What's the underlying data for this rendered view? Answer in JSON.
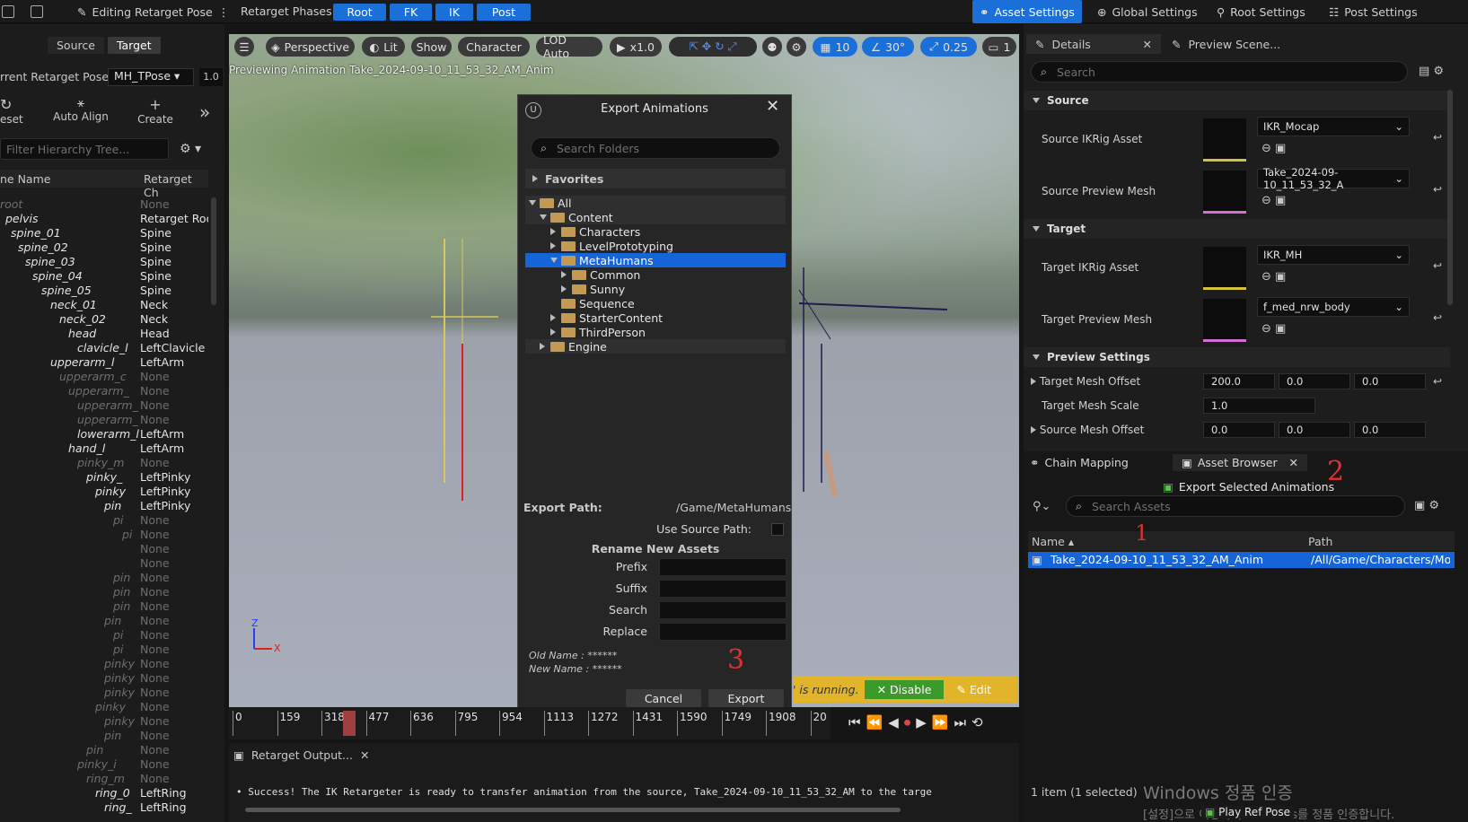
{
  "topbar": {
    "editing_label": "Editing Retarget Pose",
    "phases_label": "Retarget Phases:",
    "phases": [
      "Root",
      "FK",
      "IK",
      "Post"
    ],
    "asset_settings": "Asset Settings",
    "global_settings": "Global Settings",
    "root_settings": "Root Settings",
    "post_settings": "Post Settings"
  },
  "left": {
    "tab_source": "Source",
    "tab_target": "Target",
    "current_pose_label": "rrent Retarget Pose:",
    "current_pose_value": "MH_TPose",
    "pose_blend": "1.0",
    "reset_label": "eset",
    "auto_align_label": "Auto Align",
    "create_label": "Create",
    "filter_placeholder": "Filter Hierarchy Tree...",
    "col_name": "ne Name",
    "col_chain": "Retarget Ch",
    "rows": [
      {
        "name": "root",
        "chain": "None",
        "dim": true
      },
      {
        "name": "pelvis",
        "chain": "Retarget Roo"
      },
      {
        "name": "spine_01",
        "chain": "Spine"
      },
      {
        "name": "spine_02",
        "chain": "Spine"
      },
      {
        "name": "spine_03",
        "chain": "Spine"
      },
      {
        "name": "spine_04",
        "chain": "Spine"
      },
      {
        "name": "spine_05",
        "chain": "Spine"
      },
      {
        "name": "neck_01",
        "chain": "Neck"
      },
      {
        "name": "neck_02",
        "chain": "Neck"
      },
      {
        "name": "head",
        "chain": "Head"
      },
      {
        "name": "clavicle_l",
        "chain": "LeftClavicle"
      },
      {
        "name": "upperarm_l",
        "chain": "LeftArm"
      },
      {
        "name": "upperarm_c",
        "chain": "None",
        "dim": true
      },
      {
        "name": "upperarm_",
        "chain": "None",
        "dim": true
      },
      {
        "name": "upperarm_",
        "chain": "None",
        "dim": true
      },
      {
        "name": "upperarm_",
        "chain": "None",
        "dim": true
      },
      {
        "name": "lowerarm_l",
        "chain": "LeftArm"
      },
      {
        "name": "hand_l",
        "chain": "LeftArm"
      },
      {
        "name": "pinky_m",
        "chain": "None",
        "dim": true
      },
      {
        "name": "pinky_",
        "chain": "LeftPinky"
      },
      {
        "name": "pinky",
        "chain": "LeftPinky"
      },
      {
        "name": "pin",
        "chain": "LeftPinky"
      },
      {
        "name": "pi",
        "chain": "None",
        "dim": true
      },
      {
        "name": "pi",
        "chain": "None",
        "dim": true
      },
      {
        "name": "",
        "chain": "None",
        "dim": true
      },
      {
        "name": "",
        "chain": "None",
        "dim": true
      },
      {
        "name": "pin",
        "chain": "None",
        "dim": true
      },
      {
        "name": "pin",
        "chain": "None",
        "dim": true
      },
      {
        "name": "pin",
        "chain": "None",
        "dim": true
      },
      {
        "name": "pin",
        "chain": "None",
        "dim": true
      },
      {
        "name": "pi",
        "chain": "None",
        "dim": true
      },
      {
        "name": "pi",
        "chain": "None",
        "dim": true
      },
      {
        "name": "pinky",
        "chain": "None",
        "dim": true
      },
      {
        "name": "pinky",
        "chain": "None",
        "dim": true
      },
      {
        "name": "pinky",
        "chain": "None",
        "dim": true
      },
      {
        "name": "pinky",
        "chain": "None",
        "dim": true
      },
      {
        "name": "pinky",
        "chain": "None",
        "dim": true
      },
      {
        "name": "pin",
        "chain": "None",
        "dim": true
      },
      {
        "name": "pin",
        "chain": "None",
        "dim": true
      },
      {
        "name": "pinky_i",
        "chain": "None",
        "dim": true
      },
      {
        "name": "ring_m",
        "chain": "None",
        "dim": true
      },
      {
        "name": "ring_0",
        "chain": "LeftRing"
      },
      {
        "name": "ring_",
        "chain": "LeftRing"
      }
    ]
  },
  "viewport": {
    "view_mode": "Perspective",
    "lit": "Lit",
    "show": "Show",
    "character": "Character",
    "lod": "LOD Auto",
    "speed": "x1.0",
    "grid": "10",
    "angle": "30°",
    "scale": "0.25",
    "cam": "1",
    "preview_text": "Previewing Animation Take_2024-09-10_11_53_32_AM_Anim",
    "running_text": "' is running.",
    "disable_label": "Disable",
    "edit_label": "Edit"
  },
  "dialog": {
    "title": "Export Animations",
    "search_placeholder": "Search Folders",
    "favorites": "Favorites",
    "folders": [
      {
        "name": "All",
        "depth": 0,
        "open": true
      },
      {
        "name": "Content",
        "depth": 1,
        "open": true
      },
      {
        "name": "Characters",
        "depth": 2
      },
      {
        "name": "LevelPrototyping",
        "depth": 2
      },
      {
        "name": "MetaHumans",
        "depth": 2,
        "open": true,
        "selected": true
      },
      {
        "name": "Common",
        "depth": 3
      },
      {
        "name": "Sunny",
        "depth": 3
      },
      {
        "name": "Sequence",
        "depth": 2,
        "leaf": true
      },
      {
        "name": "StarterContent",
        "depth": 2
      },
      {
        "name": "ThirdPerson",
        "depth": 2
      },
      {
        "name": "Engine",
        "depth": 1
      }
    ],
    "export_path_label": "Export Path:",
    "export_path_value": "/Game/MetaHumans",
    "use_source_label": "Use Source Path:",
    "rename_header": "Rename New Assets",
    "prefix": "Prefix",
    "suffix": "Suffix",
    "search": "Search",
    "replace": "Replace",
    "old_name": "Old Name : ******",
    "new_name": "New Name : ******",
    "cancel": "Cancel",
    "export": "Export"
  },
  "details": {
    "tab": "Details",
    "tab2": "Preview Scene...",
    "search_placeholder": "Search",
    "source_header": "Source",
    "source_ikrig_label": "Source IKRig Asset",
    "source_ikrig_value": "IKR_Mocap",
    "source_mesh_label": "Source Preview Mesh",
    "source_mesh_value": "Take_2024-09-10_11_53_32_A",
    "target_header": "Target",
    "target_ikrig_label": "Target IKRig Asset",
    "target_ikrig_value": "IKR_MH",
    "target_mesh_label": "Target Preview Mesh",
    "target_mesh_value": "f_med_nrw_body",
    "preview_header": "Preview Settings",
    "target_offset_label": "Target Mesh Offset",
    "target_offset": [
      "200.0",
      "0.0",
      "0.0"
    ],
    "target_scale_label": "Target Mesh Scale",
    "target_scale": "1.0",
    "source_offset_label": "Source Mesh Offset",
    "source_offset": [
      "0.0",
      "0.0",
      "0.0"
    ]
  },
  "assets": {
    "tab_chain": "Chain Mapping",
    "tab_browser": "Asset Browser",
    "export_selected": "Export Selected Animations",
    "search_placeholder": "Search Assets",
    "col_name": "Name",
    "col_path": "Path",
    "row_name": "Take_2024-09-10_11_53_32_AM_Anim",
    "row_path": "/All/Game/Characters/Moc",
    "status": "1 item (1 selected)",
    "watermark": "Windows 정품 인증",
    "watermark2": "[설정]으로 이동하여 Windows를 정품 인증합니다.",
    "play_ref": "Play Ref Pose"
  },
  "timeline": {
    "ticks": [
      "0",
      "159",
      "318",
      "477",
      "636",
      "795",
      "954",
      "1113",
      "1272",
      "1431",
      "1590",
      "1749",
      "1908",
      "20"
    ]
  },
  "output": {
    "tab": "Retarget Output...",
    "message": "• Success! The IK Retargeter is ready to transfer animation from the source, Take_2024-09-10_11_53_32_AM to the targe"
  },
  "annotations": {
    "n1": "1",
    "n2": "2",
    "n3": "3"
  },
  "colors": {
    "accent": "#1a6fd8",
    "selection": "#1565d8",
    "folder": "#c49a52"
  }
}
